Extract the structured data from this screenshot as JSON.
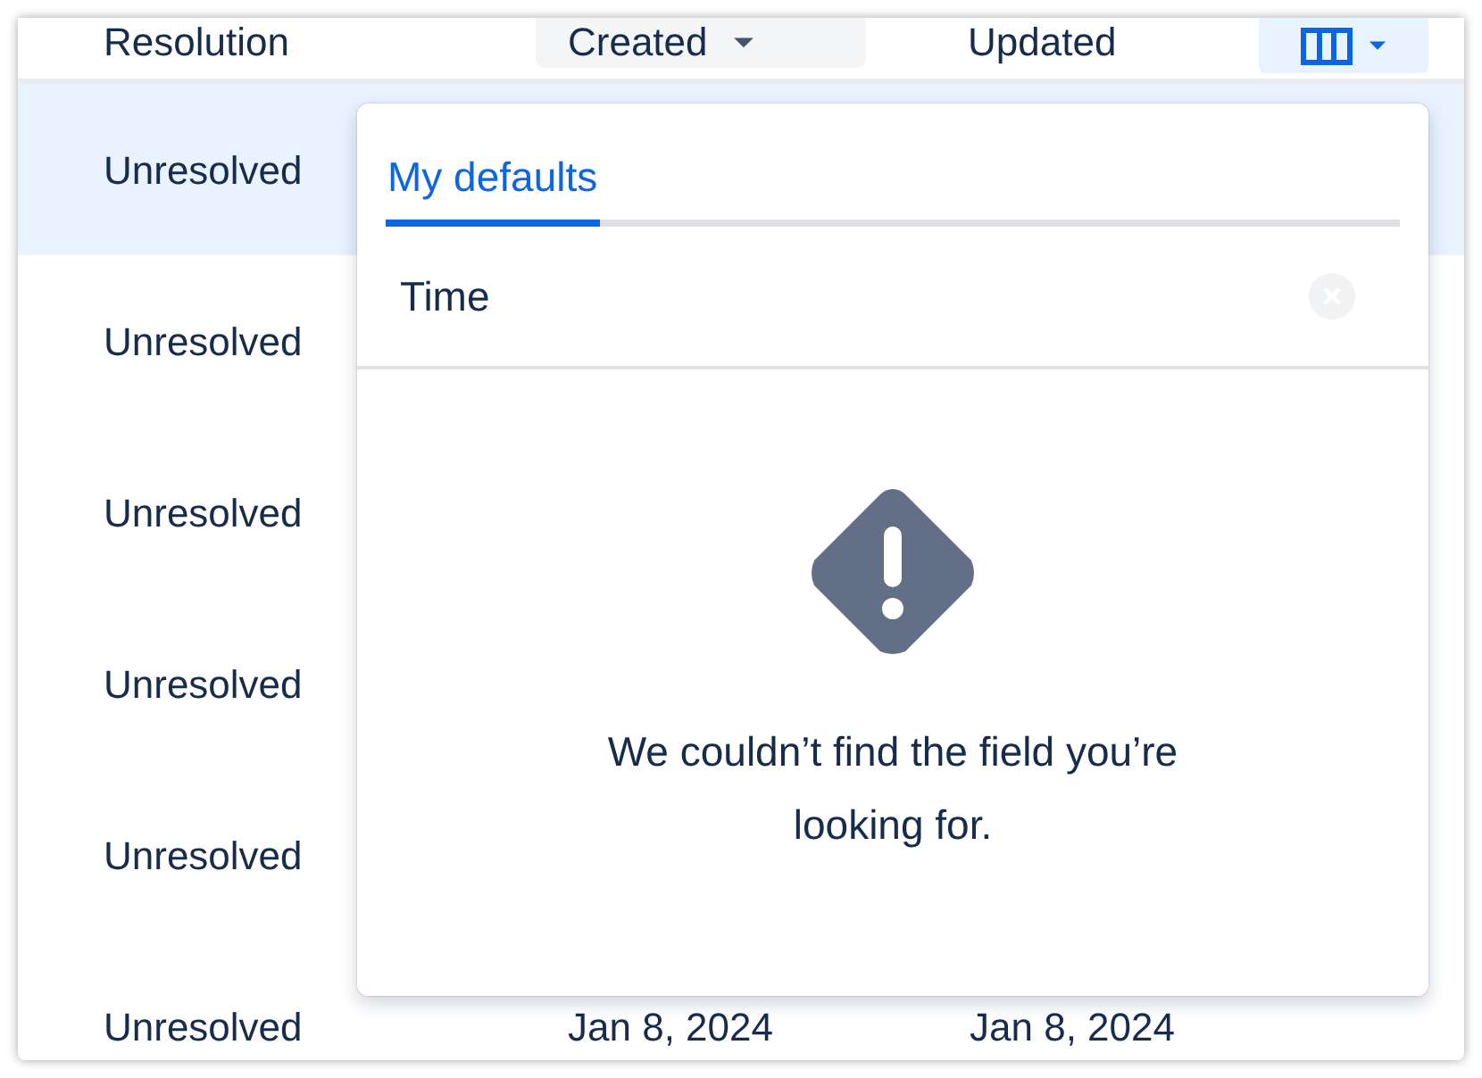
{
  "table": {
    "columns": [
      {
        "label": "Resolution",
        "sorted": false
      },
      {
        "label": "Created",
        "sorted": true
      },
      {
        "label": "Updated",
        "sorted": false
      }
    ],
    "column_picker": {
      "selected": true
    },
    "rows": [
      {
        "resolution": "Unresolved",
        "selected": true
      },
      {
        "resolution": "Unresolved",
        "selected": false
      },
      {
        "resolution": "Unresolved",
        "selected": false
      },
      {
        "resolution": "Unresolved",
        "selected": false
      },
      {
        "resolution": "Unresolved",
        "selected": false
      },
      {
        "resolution": "Unresolved",
        "selected": false,
        "created": "Jan 8, 2024",
        "updated": "Jan 8, 2024"
      }
    ]
  },
  "popup": {
    "tabs": [
      {
        "label": "My defaults",
        "selected": true
      }
    ],
    "search": {
      "value": "Time"
    },
    "empty_message": "We couldn’t find the field you’re looking for."
  }
}
